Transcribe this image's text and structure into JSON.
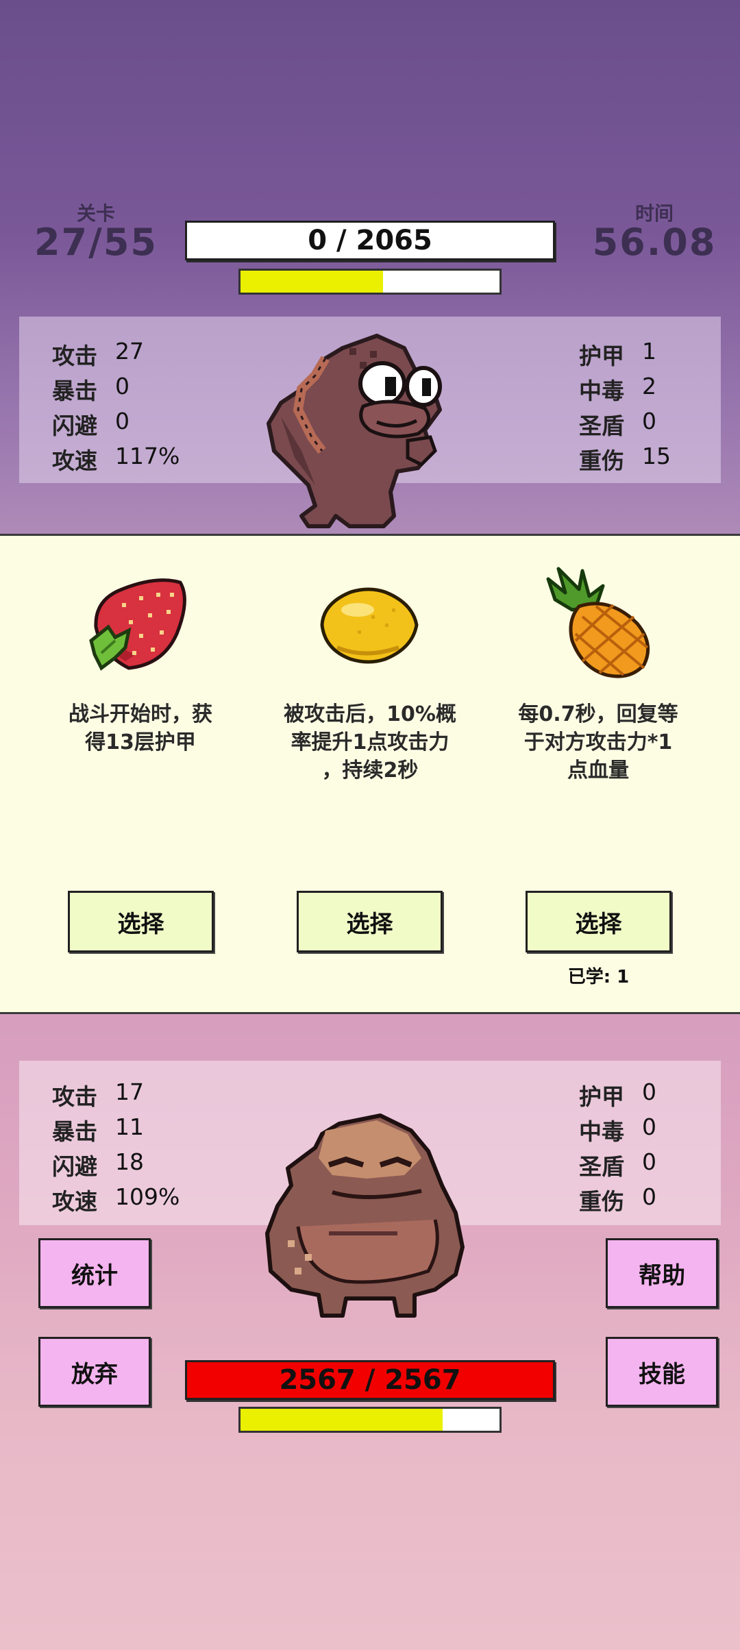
{
  "header": {
    "level_label": "关卡",
    "level_value": "27/55",
    "time_label": "时间",
    "time_value": "56.08",
    "enemy_bar_text": "0 / 2065",
    "enemy_sub_fill": 0.55
  },
  "enemy_stats": {
    "left": [
      {
        "label": "攻击",
        "value": "27"
      },
      {
        "label": "暴击",
        "value": "0"
      },
      {
        "label": "闪避",
        "value": "0"
      },
      {
        "label": "攻速",
        "value": "117%"
      }
    ],
    "right": [
      {
        "label": "护甲",
        "value": "1"
      },
      {
        "label": "中毒",
        "value": "2"
      },
      {
        "label": "圣盾",
        "value": "0"
      },
      {
        "label": "重伤",
        "value": "15"
      }
    ]
  },
  "cards": [
    {
      "icon": "strawberry-icon",
      "line1": "战斗开始时，获",
      "line2": "得13层护甲",
      "line3": "",
      "button": "选择",
      "learned": ""
    },
    {
      "icon": "lemon-icon",
      "line1": "被攻击后，10%概",
      "line2": "率提升1点攻击力",
      "line3": "，持续2秒",
      "button": "选择",
      "learned": ""
    },
    {
      "icon": "pineapple-icon",
      "line1": "每0.7秒，回复等",
      "line2": "于对方攻击力*1",
      "line3": "点血量",
      "button": "选择",
      "learned": "已学: 1"
    }
  ],
  "player_stats": {
    "left": [
      {
        "label": "攻击",
        "value": "17"
      },
      {
        "label": "暴击",
        "value": "11"
      },
      {
        "label": "闪避",
        "value": "18"
      },
      {
        "label": "攻速",
        "value": "109%"
      }
    ],
    "right": [
      {
        "label": "护甲",
        "value": "0"
      },
      {
        "label": "中毒",
        "value": "0"
      },
      {
        "label": "圣盾",
        "value": "0"
      },
      {
        "label": "重伤",
        "value": "0"
      }
    ]
  },
  "buttons": {
    "stats": "统计",
    "help": "帮助",
    "give_up": "放弃",
    "skills": "技能"
  },
  "player": {
    "hp_text": "2567 / 2567",
    "sub_fill": 0.78
  }
}
